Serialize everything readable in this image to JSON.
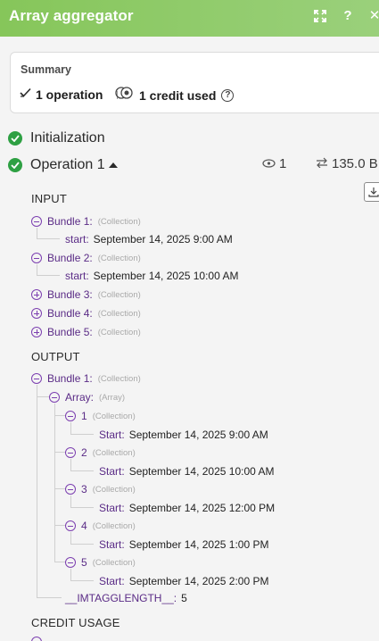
{
  "header": {
    "title": "Array aggregator"
  },
  "summary": {
    "label": "Summary",
    "operations": "1 operation",
    "credits": "1 credit used"
  },
  "ops": {
    "initialization": "Initialization",
    "operation": "Operation 1",
    "count": "1",
    "size": "135.0 B"
  },
  "sections": {
    "input": "INPUT",
    "output": "OUTPUT",
    "credit_usage": "CREDIT USAGE"
  },
  "input": {
    "bundle1": {
      "key": "Bundle 1:",
      "type": "(Collection)",
      "start_key": "start:",
      "start_val": "September 14, 2025 9:00 AM"
    },
    "bundle2": {
      "key": "Bundle 2:",
      "type": "(Collection)",
      "start_key": "start:",
      "start_val": "September 14, 2025 10:00 AM"
    },
    "bundle3": {
      "key": "Bundle 3:",
      "type": "(Collection)"
    },
    "bundle4": {
      "key": "Bundle 4:",
      "type": "(Collection)"
    },
    "bundle5": {
      "key": "Bundle 5:",
      "type": "(Collection)"
    }
  },
  "output": {
    "bundle1": {
      "key": "Bundle 1:",
      "type": "(Collection)"
    },
    "array": {
      "key": "Array:",
      "type": "(Array)"
    },
    "items": [
      {
        "key": "1",
        "type": "(Collection)",
        "start_key": "Start:",
        "start_val": "September 14, 2025 9:00 AM"
      },
      {
        "key": "2",
        "type": "(Collection)",
        "start_key": "Start:",
        "start_val": "September 14, 2025 10:00 AM"
      },
      {
        "key": "3",
        "type": "(Collection)",
        "start_key": "Start:",
        "start_val": "September 14, 2025 12:00 PM"
      },
      {
        "key": "4",
        "type": "(Collection)",
        "start_key": "Start:",
        "start_val": "September 14, 2025 1:00 PM"
      },
      {
        "key": "5",
        "type": "(Collection)",
        "start_key": "Start:",
        "start_val": "September 14, 2025 2:00 PM"
      }
    ],
    "length_key": "__IMTAGGLENGTH__:",
    "length_val": "5"
  },
  "colors": {
    "header": "#8cc963",
    "success": "#2ea043",
    "tree_key": "#5a2b86",
    "toggle": "#7c3fb0"
  }
}
